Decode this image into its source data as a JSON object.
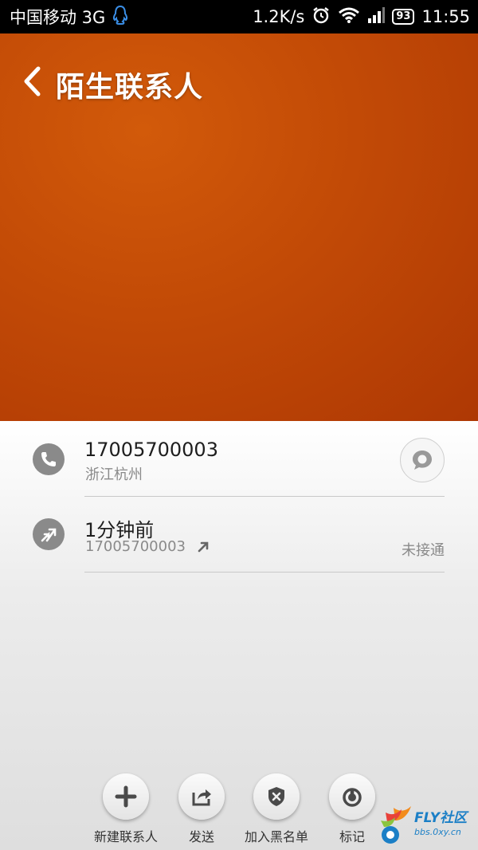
{
  "status_bar": {
    "carrier": "中国移动 3G",
    "speed": "1.2K/s",
    "battery": "93",
    "time": "11:55"
  },
  "header": {
    "title": "陌生联系人"
  },
  "contact": {
    "phone": "17005700003",
    "location": "浙江杭州"
  },
  "call_log": {
    "time": "1分钟前",
    "number": "17005700003",
    "status": "未接通"
  },
  "actions": [
    {
      "label": "新建联系人",
      "icon": "plus-icon"
    },
    {
      "label": "发送",
      "icon": "share-icon"
    },
    {
      "label": "加入黑名单",
      "icon": "shield-x-icon"
    },
    {
      "label": "标记",
      "icon": "mark-icon"
    }
  ],
  "watermark": {
    "brand": "FLY社区",
    "url": "bbs.0xy.cn"
  },
  "colors": {
    "header": "#c24a06",
    "icon_gray": "#8a8a8a",
    "watermark": "#1b7fc6"
  }
}
